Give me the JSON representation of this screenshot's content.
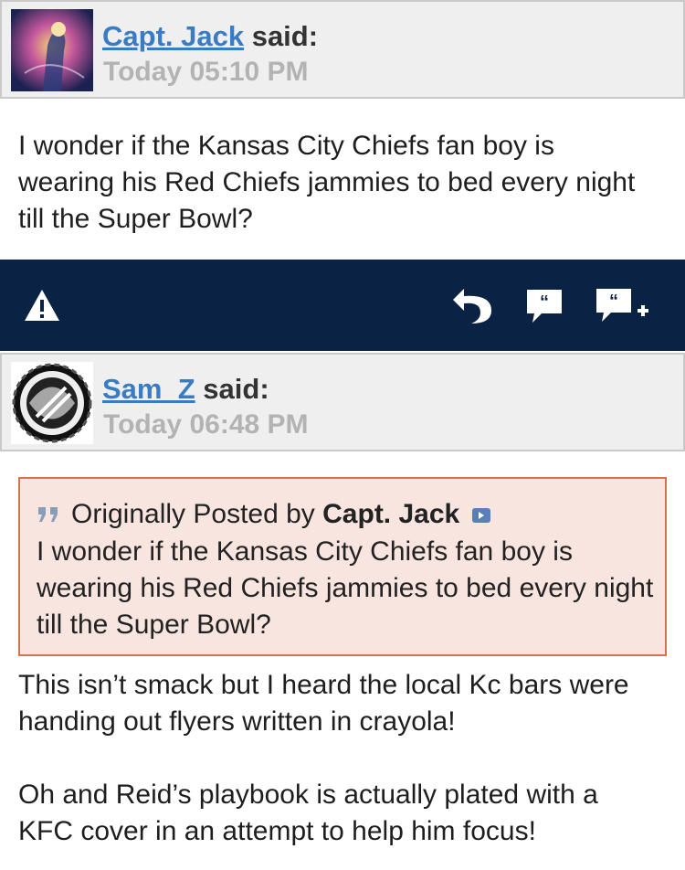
{
  "posts": [
    {
      "username": "Capt. Jack",
      "said": "said:",
      "timestamp": "Today 05:10 PM",
      "body": "I wonder if the Kansas City Chiefs fan boy is wearing his Red Chiefs jammies to bed every night till the Super Bowl?"
    },
    {
      "username": "Sam_Z",
      "said": "said:",
      "timestamp": "Today 06:48 PM",
      "quote": {
        "prefix": "Originally Posted by",
        "author": "Capt. Jack",
        "text": "I wonder if the Kansas City Chiefs fan boy is wearing his Red Chiefs jammies to bed every night till the Super Bowl?"
      },
      "body_paragraphs": [
        "This isn’t smack but I heard the local Kc bars were handing out flyers written in crayola!",
        "Oh and Reid’s playbook is actually plated with a KFC cover in an attempt to help him focus!"
      ]
    }
  ],
  "action_bar": {
    "icons": [
      "report-icon",
      "reply-icon",
      "quote-icon",
      "multi-quote-icon"
    ],
    "background": "#0a2244"
  },
  "colors": {
    "username": "#3a7cc4",
    "timestamp": "#b3b3b3",
    "quote_bg": "#f9e5df",
    "quote_border": "#d9714e"
  }
}
